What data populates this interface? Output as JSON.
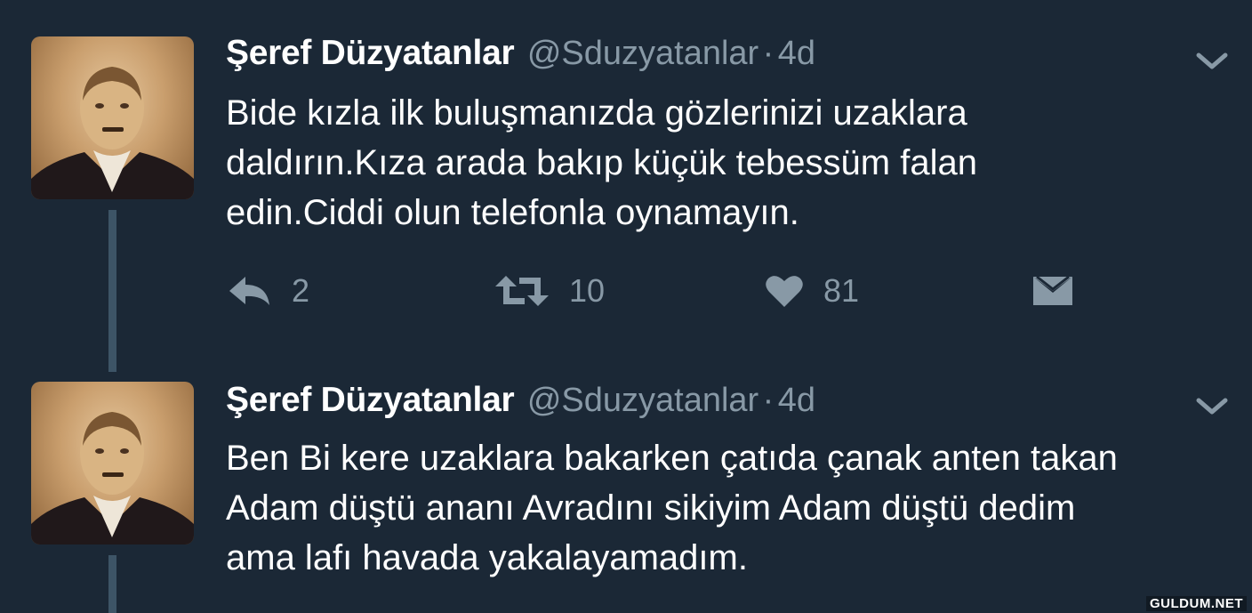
{
  "tweets": [
    {
      "name": "Şeref Düzyatanlar",
      "handle": "@Sduzyatanlar",
      "separator": "·",
      "time": "4d",
      "text_lines": [
        "Bide kızla ilk buluşmanızda gözlerinizi uzaklara",
        "daldırın.Kıza arada bakıp küçük tebessüm falan",
        "edin.Ciddi olun telefonla oynamayın."
      ],
      "actions": {
        "reply_count": "2",
        "retweet_count": "10",
        "like_count": "81"
      }
    },
    {
      "name": "Şeref Düzyatanlar",
      "handle": "@Sduzyatanlar",
      "separator": "·",
      "time": "4d",
      "text_lines": [
        "Ben Bi kere uzaklara bakarken çatıda çanak anten takan",
        "Adam düştü ananı Avradını sikiyim Adam düştü dedim",
        "ama lafı havada yakalayamadım."
      ]
    }
  ],
  "icons": {
    "reply": "reply-icon",
    "retweet": "retweet-icon",
    "like": "heart-icon",
    "dm": "envelope-icon",
    "caret": "chevron-down-icon"
  },
  "colors": {
    "background": "#1b2836",
    "secondary_text": "#8899a6",
    "thread_line": "#3d5466"
  },
  "watermark": "GULDUM.NET"
}
